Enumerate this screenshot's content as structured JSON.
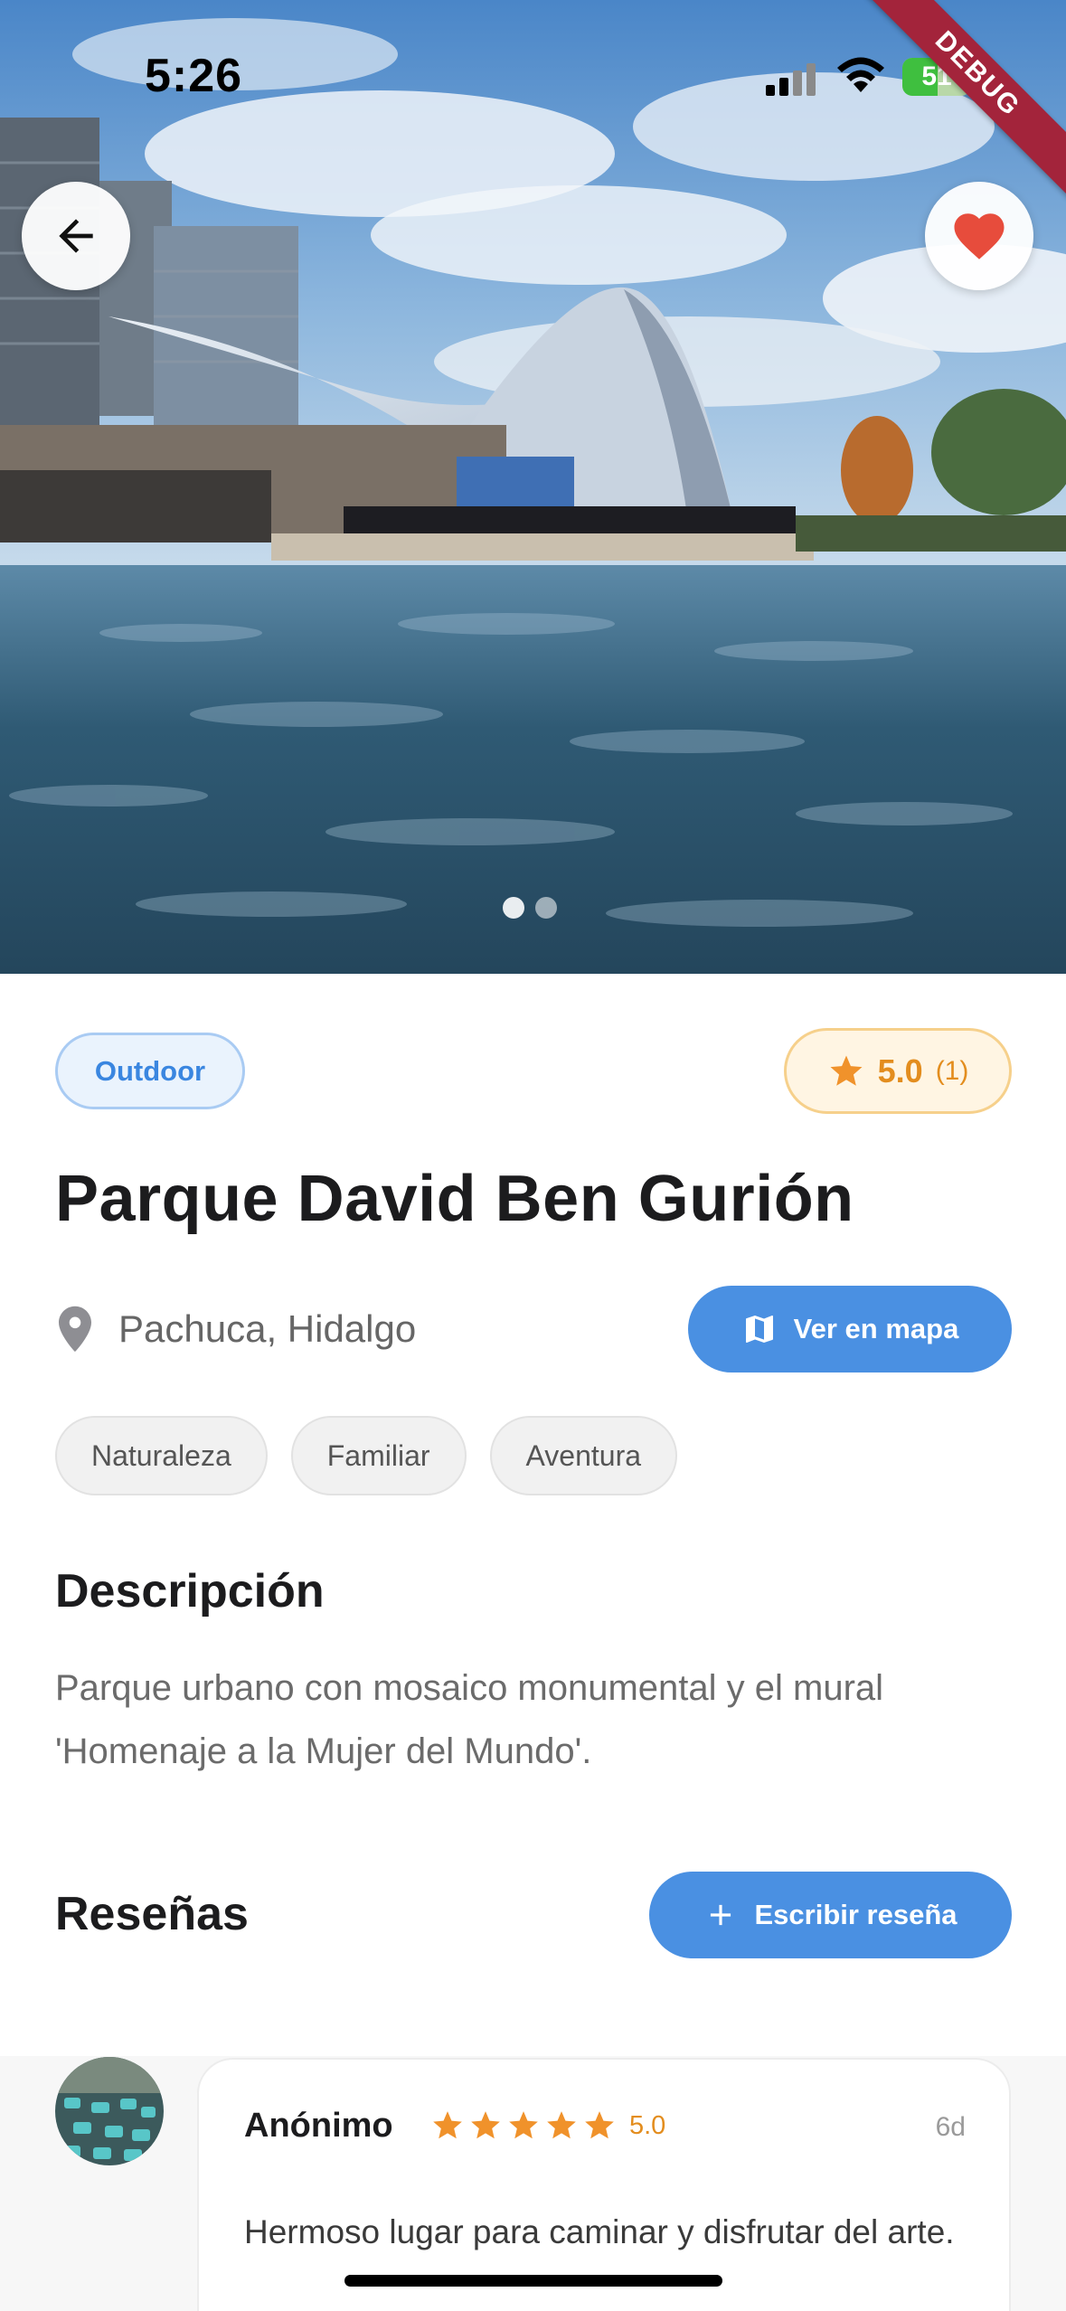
{
  "status_bar": {
    "time": "5:26",
    "battery_level": "51",
    "battery_fill_fraction": 0.51
  },
  "debug_banner": "DEBUG",
  "hero": {
    "back_icon": "arrow-left-icon",
    "favorite_icon": "heart-icon",
    "favorite_color": "#e74c3c",
    "page_count": 2,
    "active_page": 1
  },
  "place": {
    "type_chip": "Outdoor",
    "rating": "5.0",
    "rating_count": "(1)",
    "title": "Parque David Ben Gurión",
    "location": "Pachuca, Hidalgo",
    "map_button": "Ver en mapa",
    "tags": [
      "Naturaleza",
      "Familiar",
      "Aventura"
    ]
  },
  "description": {
    "title": "Descripción",
    "body": "Parque urbano con mosaico monumental y el mural 'Homenaje a la Mujer del Mundo'."
  },
  "reviews": {
    "title": "Reseñas",
    "write_button": "Escribir reseña",
    "items": [
      {
        "author": "Anónimo",
        "stars": 5,
        "score": "5.0",
        "date": "6d",
        "text": "Hermoso lugar para caminar y disfrutar del arte."
      }
    ]
  },
  "colors": {
    "accent": "#4a90e2",
    "star": "#f0922b",
    "rating_bg": "#fff5e3",
    "type_chip_bg": "#eaf3fd"
  }
}
